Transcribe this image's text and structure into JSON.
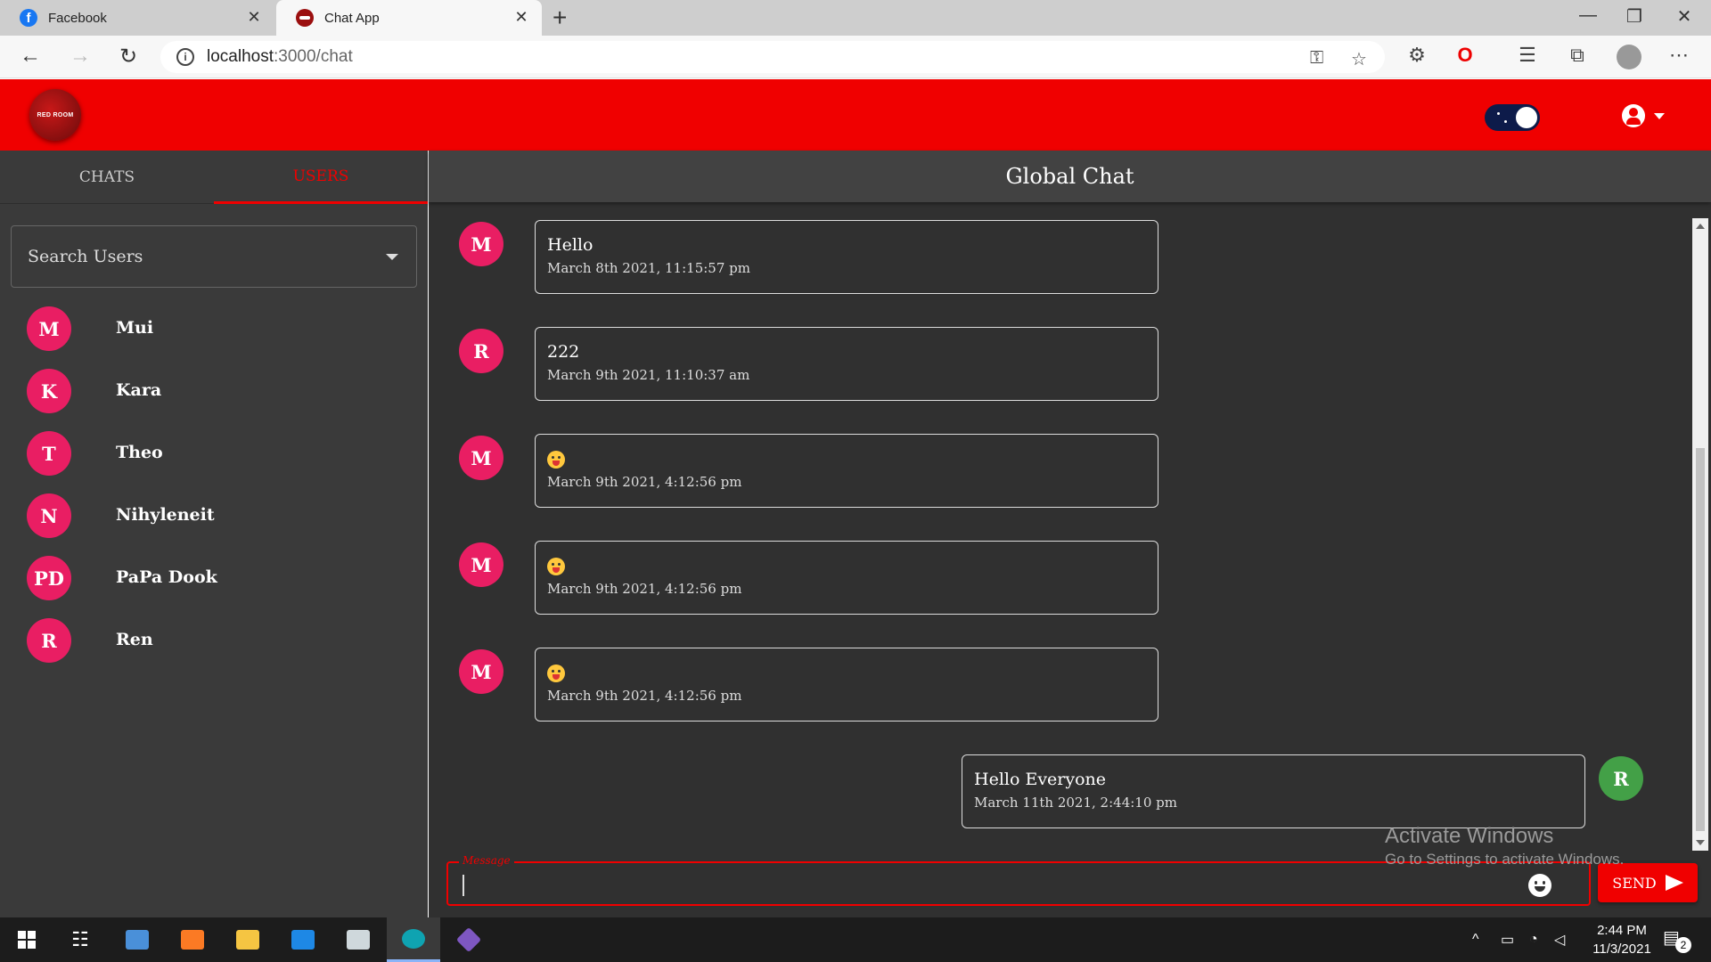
{
  "browser": {
    "tabs": [
      {
        "title": "Facebook",
        "icon": "facebook-icon"
      },
      {
        "title": "Chat App",
        "icon": "app-favicon",
        "active": true
      }
    ],
    "url_host": "localhost",
    "url_path": ":3000/chat"
  },
  "app": {
    "logo_text": "RED ROOM",
    "theme_toggle": "dark",
    "accent_color": "#f00000",
    "avatar_color": "#e91e63"
  },
  "sidebar": {
    "tabs": [
      {
        "label": "CHATS",
        "active": false
      },
      {
        "label": "USERS",
        "active": true
      }
    ],
    "search_label": "Search Users",
    "users": [
      {
        "initials": "M",
        "name": "Mui"
      },
      {
        "initials": "K",
        "name": "Kara"
      },
      {
        "initials": "T",
        "name": "Theo"
      },
      {
        "initials": "N",
        "name": "Nihyleneit"
      },
      {
        "initials": "PD",
        "name": "PaPa Dook"
      },
      {
        "initials": "R",
        "name": "Ren"
      }
    ]
  },
  "chat": {
    "title": "Global Chat",
    "messages": [
      {
        "initials": "M",
        "text": "Hello",
        "time": "March 8th 2021, 11:15:57 pm",
        "emoji": false,
        "own": false
      },
      {
        "initials": "R",
        "text": "222",
        "time": "March 9th 2021, 11:10:37 am",
        "emoji": false,
        "own": false
      },
      {
        "initials": "M",
        "text": "",
        "time": "March 9th 2021, 4:12:56 pm",
        "emoji": true,
        "own": false
      },
      {
        "initials": "M",
        "text": "",
        "time": "March 9th 2021, 4:12:56 pm",
        "emoji": true,
        "own": false
      },
      {
        "initials": "M",
        "text": "",
        "time": "March 9th 2021, 4:12:56 pm",
        "emoji": true,
        "own": false
      },
      {
        "initials": "R",
        "text": "Hello Everyone",
        "time": "March 11th 2021, 2:44:10 pm",
        "emoji": false,
        "own": true
      }
    ],
    "input_label": "Message",
    "input_value": "",
    "send_label": "SEND"
  },
  "watermark": {
    "line1": "Activate Windows",
    "line2": "Go to Settings to activate Windows."
  },
  "taskbar": {
    "time": "2:44 PM",
    "date": "11/3/2021",
    "notification_count": "2"
  }
}
